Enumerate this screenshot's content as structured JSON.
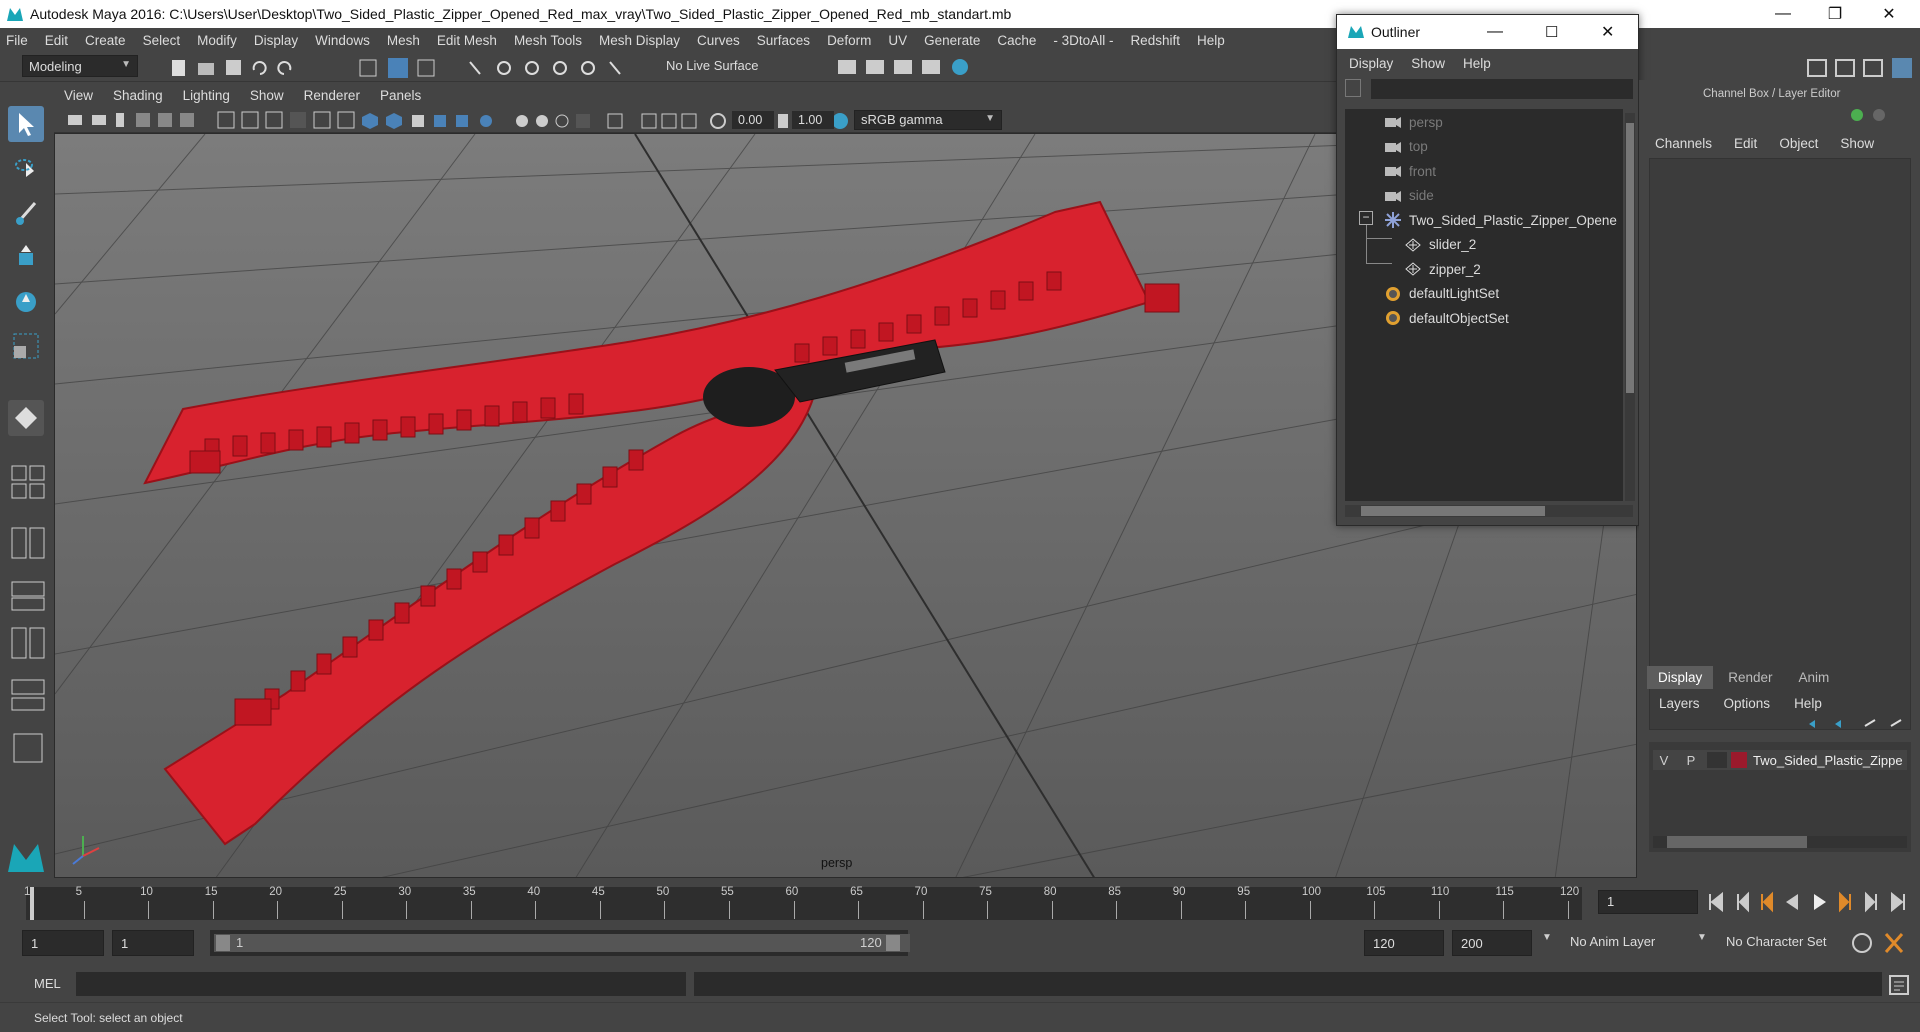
{
  "window": {
    "title": "Autodesk Maya 2016: C:\\Users\\User\\Desktop\\Two_Sided_Plastic_Zipper_Opened_Red_max_vray\\Two_Sided_Plastic_Zipper_Opened_Red_mb_standart.mb"
  },
  "menubar": [
    "File",
    "Edit",
    "Create",
    "Select",
    "Modify",
    "Display",
    "Windows",
    "Mesh",
    "Edit Mesh",
    "Mesh Tools",
    "Mesh Display",
    "Curves",
    "Surfaces",
    "Deform",
    "UV",
    "Generate",
    "Cache",
    "- 3DtoAll -",
    "Redshift",
    "Help"
  ],
  "shelf": {
    "mode": "Modeling",
    "live_surface": "No Live Surface"
  },
  "panel_menu": [
    "View",
    "Shading",
    "Lighting",
    "Show",
    "Renderer",
    "Panels"
  ],
  "view_toolbar": {
    "exposure": "0.00",
    "gamma": "1.00",
    "colorspace": "sRGB gamma"
  },
  "viewport": {
    "camera_label": "persp",
    "model_color": "#d8222e"
  },
  "outliner": {
    "title": "Outliner",
    "menus": [
      "Display",
      "Show",
      "Help"
    ],
    "items": [
      {
        "label": "persp",
        "icon": "camera-icon",
        "dim": true
      },
      {
        "label": "top",
        "icon": "camera-icon",
        "dim": true
      },
      {
        "label": "front",
        "icon": "camera-icon",
        "dim": true
      },
      {
        "label": "side",
        "icon": "camera-icon",
        "dim": true
      },
      {
        "label": "Two_Sided_Plastic_Zipper_Opene",
        "icon": "group-icon",
        "dim": false
      },
      {
        "label": "slider_2",
        "icon": "mesh-icon",
        "dim": false
      },
      {
        "label": "zipper_2",
        "icon": "mesh-icon",
        "dim": false
      },
      {
        "label": "defaultLightSet",
        "icon": "set-icon",
        "dim": false
      },
      {
        "label": "defaultObjectSet",
        "icon": "set-icon",
        "dim": false
      }
    ]
  },
  "channel_box": {
    "title": "Channel Box / Layer Editor",
    "menus": [
      "Channels",
      "Edit",
      "Object",
      "Show"
    ],
    "layer_tabs": [
      "Display",
      "Render",
      "Anim"
    ],
    "layer_menus": [
      "Layers",
      "Options",
      "Help"
    ],
    "layer": {
      "v": "V",
      "p": "P",
      "name": "Two_Sided_Plastic_Zippe",
      "color": "#9b1a2c"
    }
  },
  "timeline": {
    "ticks": [
      "5",
      "10",
      "15",
      "20",
      "25",
      "30",
      "35",
      "40",
      "45",
      "50",
      "55",
      "60",
      "65",
      "70",
      "75",
      "80",
      "85",
      "90",
      "95",
      "100",
      "105",
      "110",
      "115",
      "120"
    ],
    "start_tick": "1",
    "current_frame": "1"
  },
  "range": {
    "start": "1",
    "start2": "1",
    "slider_start": "1",
    "slider_end": "120",
    "end": "120",
    "end2": "200",
    "anim_layer": "No Anim Layer",
    "char_set": "No Character Set"
  },
  "cmd": {
    "label": "MEL"
  },
  "help": {
    "text": "Select Tool: select an object"
  }
}
